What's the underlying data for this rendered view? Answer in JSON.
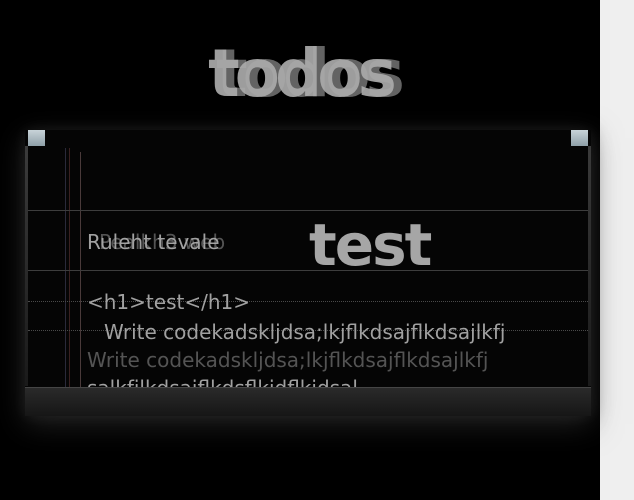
{
  "app": {
    "title": "todos"
  },
  "todos": [
    {
      "label": "Ruleht tevale",
      "overlap": "Pealkh3 web"
    },
    {
      "label": "<h1>test</h1>"
    },
    {
      "label": "Write codekadskljdsa;lkjflkdsajflkdsajlkfj",
      "overlap": "Write codekadskljdsa;lkjflkdsajflkdsajlkfj",
      "extra": "salkfjlkdsajflkdsflkjdflkjdsal"
    }
  ],
  "preview": {
    "heading": "test"
  },
  "colors": {
    "background": "#000000",
    "text": "#aaaaaa",
    "page_side": "#efefef",
    "corner_accent": "#b6c4ca"
  }
}
